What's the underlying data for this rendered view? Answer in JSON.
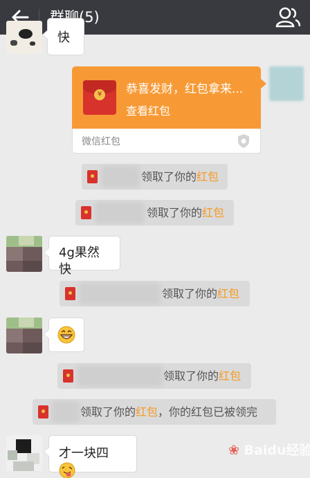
{
  "header": {
    "title": "群聊(5)",
    "back_icon": "arrow-left-icon",
    "members_icon": "people-icon"
  },
  "colors": {
    "topbar": "#393a3f",
    "accent_orange": "#f79a35",
    "highlight": "#f59a23",
    "envelope_red": "#d8322c"
  },
  "messages": {
    "m1": "快",
    "red_packet": {
      "title": "恭喜发财，红包拿来...",
      "subtitle": "查看红包",
      "footer": "微信红包"
    },
    "m2": "4g果然快",
    "m4": "才一块四"
  },
  "system": {
    "claimed_prefix": "领取了你的",
    "claimed_link": "红包",
    "last_suffix": "，你的红包已被领完"
  },
  "watermark": "Baidu经验"
}
